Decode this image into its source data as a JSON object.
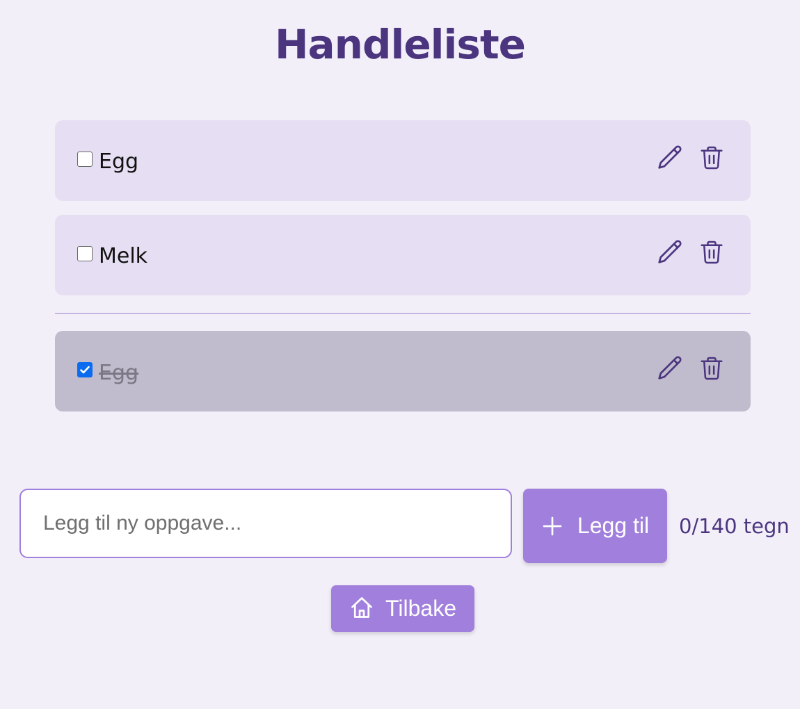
{
  "title": "Handleliste",
  "items": [
    {
      "label": "Egg",
      "checked": false
    },
    {
      "label": "Melk",
      "checked": false
    }
  ],
  "done_items": [
    {
      "label": "Egg",
      "checked": true
    }
  ],
  "input": {
    "placeholder": "Legg til ny oppgave...",
    "value": ""
  },
  "add_button": {
    "label": "Legg til",
    "icon": "plus-icon"
  },
  "counter": "0/140 tegn",
  "back_button": {
    "label": "Tilbake",
    "icon": "home-icon"
  },
  "colors": {
    "background": "#f3eff9",
    "accent": "#a17fdc",
    "title": "#4b357f",
    "item_bg": "#e6dff3",
    "done_item_bg": "#c1bccd"
  }
}
